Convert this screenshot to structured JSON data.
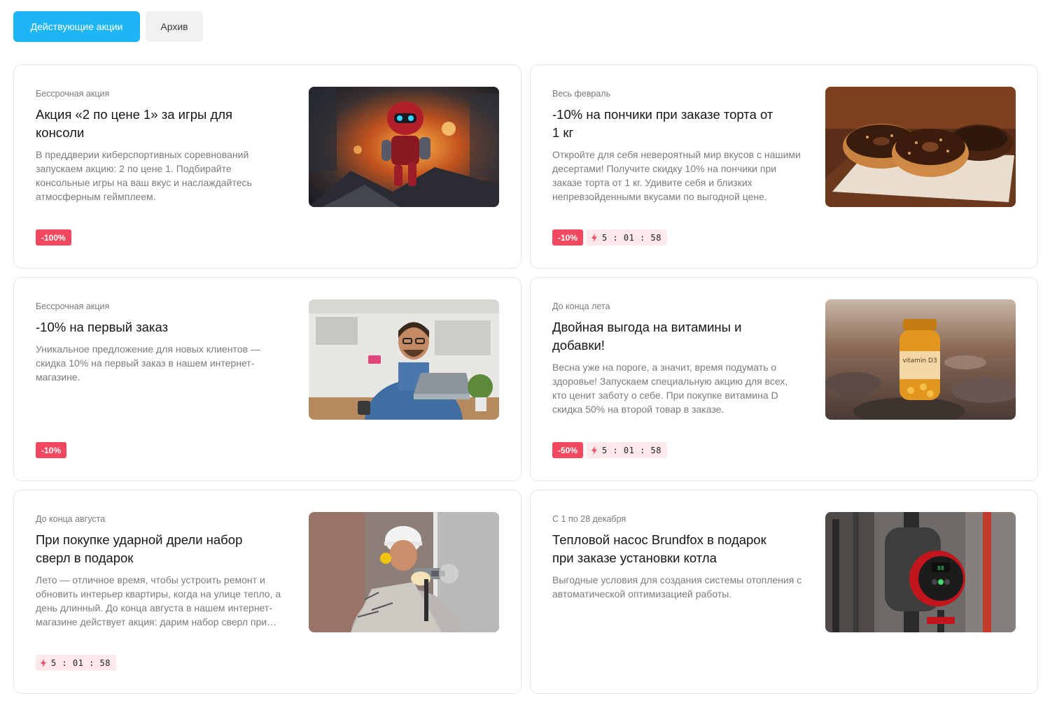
{
  "tabs": {
    "active_label": "Действующие акции",
    "archive_label": "Архив"
  },
  "colors": {
    "accent": "#1eb5f5",
    "discount_badge": "#f0485f",
    "timer_badge_bg": "#fde8ea"
  },
  "icons": {
    "timer": "lightning-icon"
  },
  "promos": [
    {
      "period": "Бессрочная акция",
      "title": "Акция «2 по цене 1» за игры для консоли",
      "description": "В преддверии киберспортивных соревнований запускаем акцию: 2 по цене 1. Подбирайте консольные игры на ваш вкус и наслаждайтесь атмосферным геймплеем.",
      "discount": "-100%",
      "timer": "",
      "image": "robot-explosion-image"
    },
    {
      "period": "Весь февраль",
      "title": "-10% на пончики при заказе торта от 1 кг",
      "description": "Откройте для себя невероятный мир вкусов с нашими десертами! Получите скидку 10% на пончики при заказе торта от 1 кг. Удивите себя и близких непревзойденными вкусами по выгодной цене.",
      "discount": "-10%",
      "timer": "5 : 01 : 58",
      "image": "donuts-image"
    },
    {
      "period": "Бессрочная акция",
      "title": "-10% на первый заказ",
      "description": "Уникальное предложение для новых клиентов — скидка 10% на первый заказ в нашем интернет-магазине.",
      "discount": "-10%",
      "timer": "",
      "image": "man-with-card-image"
    },
    {
      "period": "До конца лета",
      "title": "Двойная выгода на витамины и добавки!",
      "description": "Весна уже на пороге, а значит, время подумать о здоровье! Запускаем специальную акцию для всех, кто ценит заботу о себе. При покупке витамина D скидка 50% на второй товар в заказе.",
      "discount": "-50%",
      "timer": "5 : 01 : 58",
      "image": "vitamin-d3-image",
      "image_label": "vitamin D3"
    },
    {
      "period": "До конца августа",
      "title": "При покупке ударной дрели набор сверл в подарок",
      "description": "Лето — отличное время, чтобы устроить ремонт и обновить интерьер квартиры, когда на улице тепло, а день длинный. До конца августа в нашем интернет-магазине действует акция: дарим набор сверл при покупке ударной дрели.",
      "discount": "",
      "timer": "5 : 01 : 58",
      "image": "worker-drill-image"
    },
    {
      "period": "С 1 по 28 декабря",
      "title": "Тепловой насос Brundfox в подарок при заказе установки котла",
      "description": "Выгодные условия для создания системы отопления с автоматической оптимизацией работы.",
      "discount": "",
      "timer": "",
      "image": "heat-pump-image"
    }
  ]
}
